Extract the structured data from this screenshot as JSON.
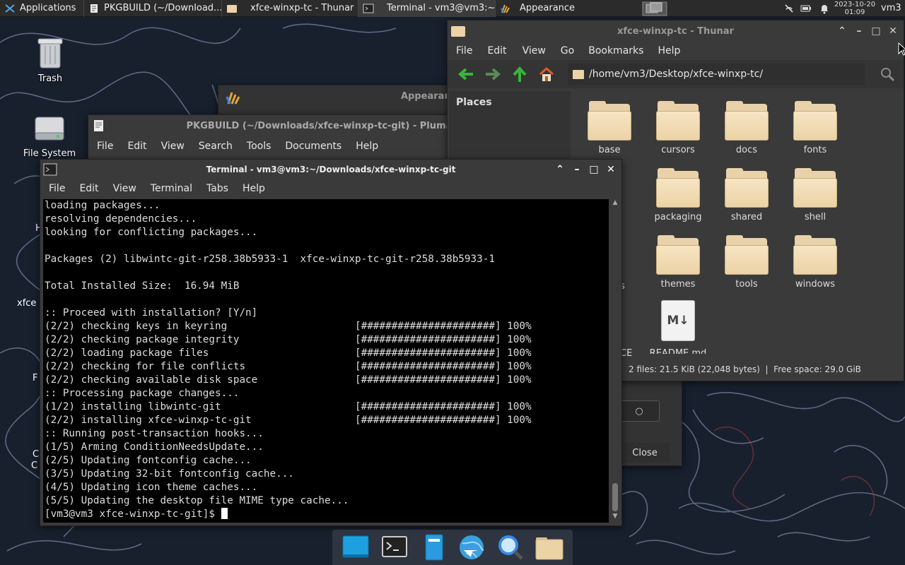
{
  "panel": {
    "applications_label": "Applications",
    "tasks": [
      {
        "label": "PKGBUILD (~/Download..."
      },
      {
        "label": "xfce-winxp-tc - Thunar"
      },
      {
        "label": "Terminal - vm3@vm3:~/..."
      },
      {
        "label": "Appearance"
      }
    ],
    "date": "2023-10-20",
    "time": "01:09",
    "user": "vm3"
  },
  "desktop": {
    "icons": [
      {
        "label": "Trash"
      },
      {
        "label": "File System"
      }
    ],
    "partial_labels": [
      "H",
      "xfce",
      "F",
      "C",
      "C"
    ]
  },
  "appearance_window": {
    "title": "Appearan",
    "close_button": "Close"
  },
  "pluma": {
    "title": "PKGBUILD (~/Downloads/xfce-winxp-tc-git) - Pluma",
    "menu": [
      "File",
      "Edit",
      "View",
      "Search",
      "Tools",
      "Documents",
      "Help"
    ]
  },
  "thunar": {
    "title": "xfce-winxp-tc - Thunar",
    "menu": [
      "File",
      "Edit",
      "View",
      "Go",
      "Bookmarks",
      "Help"
    ],
    "path": "/home/vm3/Desktop/xfce-winxp-tc/",
    "places_label": "Places",
    "items": [
      "base",
      "cursors",
      "docs",
      "fonts",
      "packaging",
      "shared",
      "shell",
      "themes",
      "tools",
      "windows",
      "README.md"
    ],
    "partial_items": [
      "s",
      "CE"
    ],
    "readme_icon_text": "M↓",
    "status": "2 files: 21.5 KiB (22,048 bytes)  |  Free space: 29.0 GiB"
  },
  "terminal": {
    "title": "Terminal - vm3@vm3:~/Downloads/xfce-winxp-tc-git",
    "menu": [
      "File",
      "Edit",
      "View",
      "Terminal",
      "Tabs",
      "Help"
    ],
    "lines": [
      "loading packages...",
      "resolving dependencies...",
      "looking for conflicting packages...",
      "",
      "Packages (2) libwintc-git-r258.38b5933-1  xfce-winxp-tc-git-r258.38b5933-1",
      "",
      "Total Installed Size:  16.94 MiB",
      "",
      ":: Proceed with installation? [Y/n]",
      "(2/2) checking keys in keyring                     [######################] 100%",
      "(2/2) checking package integrity                   [######################] 100%",
      "(2/2) loading package files                        [######################] 100%",
      "(2/2) checking for file conflicts                  [######################] 100%",
      "(2/2) checking available disk space                [######################] 100%",
      ":: Processing package changes...",
      "(1/2) installing libwintc-git                      [######################] 100%",
      "(2/2) installing xfce-winxp-tc-git                 [######################] 100%",
      ":: Running post-transaction hooks...",
      "(1/5) Arming ConditionNeedsUpdate...",
      "(2/5) Updating fontconfig cache...",
      "(3/5) Updating 32-bit fontconfig cache...",
      "(4/5) Updating icon theme caches...",
      "(5/5) Updating the desktop file MIME type cache..."
    ],
    "prompt": "[vm3@vm3 xfce-winxp-tc-git]$ "
  },
  "dock": {
    "items": [
      "desktop-icon",
      "terminal-icon",
      "text-editor-icon",
      "web-browser-icon",
      "search-icon",
      "file-manager-icon"
    ]
  },
  "colors": {
    "panel": "#2b2b2b",
    "window": "#3a3a3a",
    "terminal_bg": "#000000",
    "folder": "#ecd3a6",
    "nav_green": "#3bb33b"
  }
}
